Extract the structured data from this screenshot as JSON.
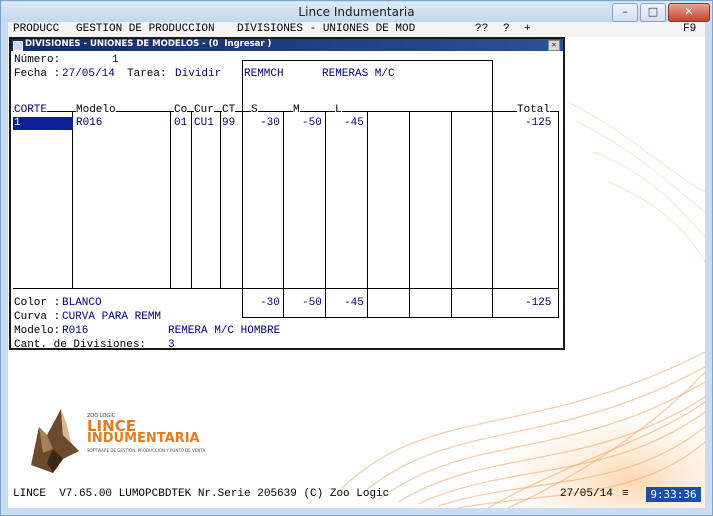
{
  "window": {
    "title": "Lince Indumentaria"
  },
  "menubar": {
    "items": [
      "PRODUCC",
      "GESTION DE PRODUCCION",
      "DIVISIONES - UNIONES DE MOD",
      "??",
      "?",
      "+",
      "F9"
    ]
  },
  "dialog": {
    "title": "DIVISIONES - UNIONES DE MODELOS - (0  Ingresar )",
    "numero_label": "Número:",
    "numero_value": "1",
    "fecha_label": "Fecha :",
    "fecha_value": "27/05/14",
    "tarea_label": "Tarea:",
    "tarea_value": "Dividir",
    "curve_code": "REMMCH",
    "curve_desc": "REMERAS M/C",
    "columns": {
      "corte": "CORTE",
      "modelo": "Modelo",
      "co": "Co",
      "cur": "Cur",
      "ct": "CT",
      "s": "S",
      "m": "M",
      "l": "L",
      "total": "Total"
    },
    "row": {
      "corte": "1",
      "modelo": "R016",
      "co": "01",
      "cur": "CU1",
      "ct": "99",
      "s": "-30",
      "m": "-50",
      "l": "-45",
      "total": "-125"
    },
    "totals": {
      "s": "-30",
      "m": "-50",
      "l": "-45",
      "total": "-125"
    },
    "color_label": "Color :",
    "color_value": "BLANCO",
    "curva_label": "Curva :",
    "curva_value": "CURVA PARA REMM",
    "modelo_label": "Modelo:",
    "modelo_value": "R016",
    "modelo_desc": "REMERA M/C HOMBRE",
    "cant_label": "Cant. de Divisiones:",
    "cant_value": "3"
  },
  "logo": {
    "brand_small": "ZOO LOGIC",
    "brand_line1": "LINCE",
    "brand_line2": "INDUMENTARIA",
    "tagline": "SOFTWARE DE GESTIÓN, PRODUCCIÓN Y PUNTO DE VENTA"
  },
  "status": {
    "left": "LINCE  V7.65.00 LUMOPCBDTEK Nr.Serie 205639 (C) Zoo Logic",
    "date": "27/05/14",
    "icon": "menu-icon",
    "clock": "9:33:36"
  },
  "colors": {
    "dialog_title_bg": "#1b3a80",
    "corte_highlight": "#0b1f9a",
    "text_navy": "#00007a",
    "clock_bg": "#1f4da6",
    "swirl": "#f2a05c"
  }
}
